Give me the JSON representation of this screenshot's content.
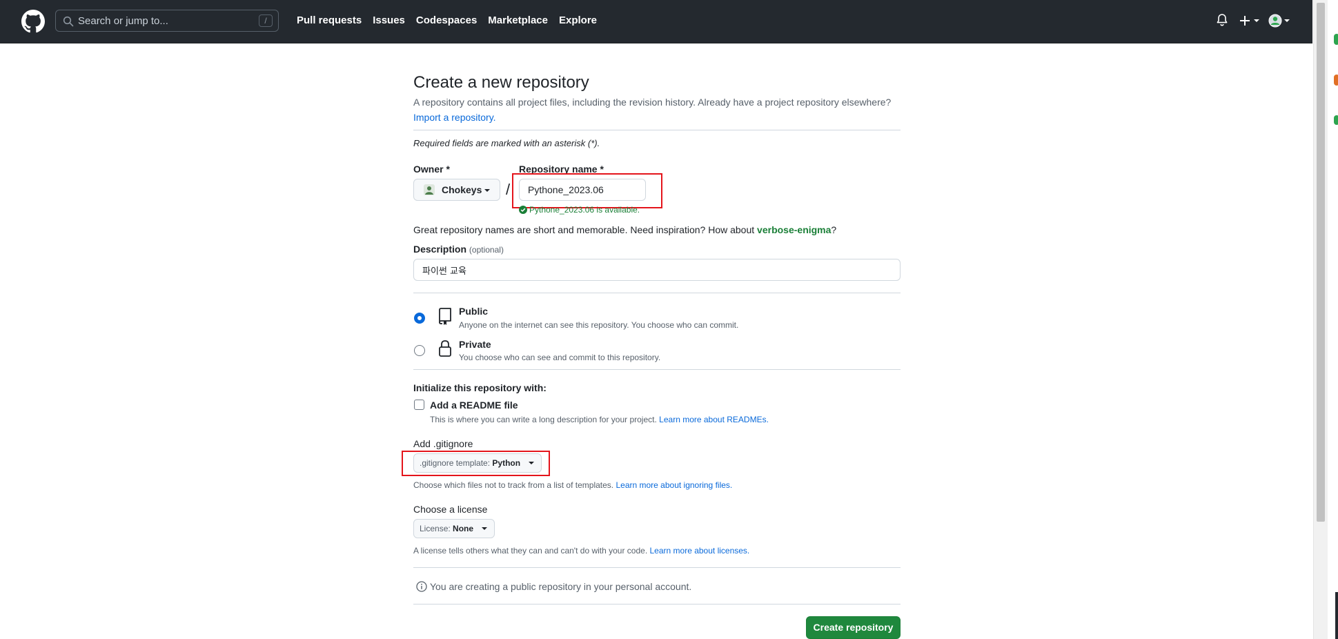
{
  "header": {
    "search_placeholder": "Search or jump to...",
    "search_shortcut": "/",
    "nav": [
      "Pull requests",
      "Issues",
      "Codespaces",
      "Marketplace",
      "Explore"
    ]
  },
  "form": {
    "title": "Create a new repository",
    "intro": "A repository contains all project files, including the revision history. Already have a project repository elsewhere?",
    "import_link": "Import a repository.",
    "required_note": "Required fields are marked with an asterisk (*).",
    "owner_label": "Owner *",
    "owner_name": "Chokeys",
    "separator": "/",
    "repo_label": "Repository name *",
    "repo_value": "Pythone_2023.06",
    "availability": "Pythone_2023.06 is available.",
    "inspiration_prefix": "Great repository names are short and memorable. Need inspiration? How about ",
    "inspiration_suggestion": "verbose-enigma",
    "inspiration_suffix": "?",
    "description_label": "Description",
    "description_optional": "(optional)",
    "description_value": "파이썬 교육",
    "visibility": {
      "selected": "public",
      "public_title": "Public",
      "public_desc": "Anyone on the internet can see this repository. You choose who can commit.",
      "private_title": "Private",
      "private_desc": "You choose who can see and commit to this repository."
    },
    "init_label": "Initialize this repository with:",
    "readme_label": "Add a README file",
    "readme_checked": false,
    "readme_desc": "This is where you can write a long description for your project.",
    "readme_link": "Learn more about READMEs.",
    "gitignore_label": "Add .gitignore",
    "gitignore_prefix": ".gitignore template:",
    "gitignore_value": "Python",
    "gitignore_desc": "Choose which files not to track from a list of templates.",
    "gitignore_link": "Learn more about ignoring files.",
    "license_label": "Choose a license",
    "license_prefix": "License:",
    "license_value": "None",
    "license_desc": "A license tells others what they can and can't do with your code.",
    "license_link": "Learn more about licenses.",
    "notice": "You are creating a public repository in your personal account.",
    "submit_label": "Create repository"
  },
  "colors": {
    "header_bg": "#24292f",
    "primary_button": "#1f883d",
    "link": "#0969da",
    "success": "#1a7f37",
    "highlight_box": "#e4141b"
  }
}
